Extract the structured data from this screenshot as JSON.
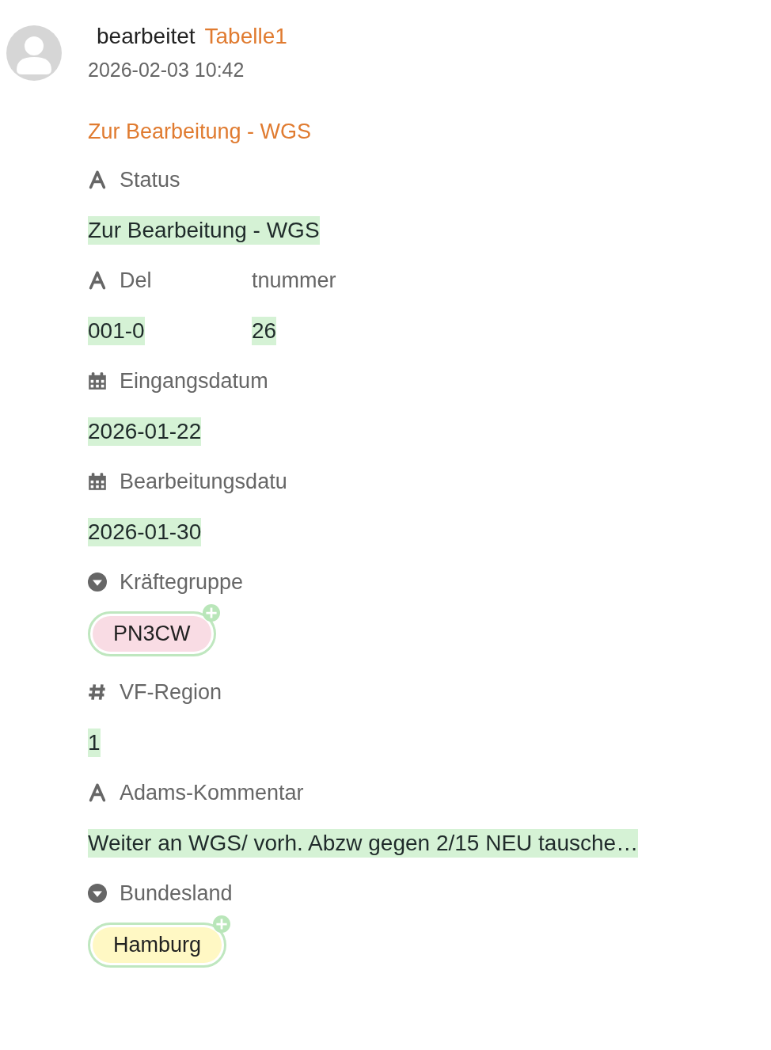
{
  "header": {
    "action": "bearbeitet",
    "table": "Tabelle1",
    "timestamp": "2026-02-03 10:42"
  },
  "record_title": "Zur Bearbeitung - WGS",
  "fields": [
    {
      "kind": "text",
      "label": [
        "Status"
      ],
      "value": [
        "Zur Bearbeitung - WGS"
      ]
    },
    {
      "kind": "text",
      "label": [
        "Del",
        "tnummer"
      ],
      "value": [
        "001-0",
        "26"
      ]
    },
    {
      "kind": "date",
      "label": [
        "Eingangsdatum"
      ],
      "value": [
        "2026-01-22"
      ]
    },
    {
      "kind": "date",
      "label": [
        "Bearbeitungsdatu"
      ],
      "value": [
        "2026-01-30"
      ]
    },
    {
      "kind": "select",
      "label": [
        "Kräftegruppe"
      ],
      "option": {
        "text": "PN3CW",
        "color": "#f9dce4"
      }
    },
    {
      "kind": "number",
      "label": [
        "VF-Region"
      ],
      "value": [
        "1"
      ]
    },
    {
      "kind": "text",
      "label": [
        "Adams-Kommentar"
      ],
      "value": [
        "Weiter an WGS/ vorh. Abzw gegen 2/15 NEU tausche…"
      ]
    },
    {
      "kind": "select",
      "label": [
        "Bundesland"
      ],
      "option": {
        "text": "Hamburg",
        "color": "#fff8c4"
      }
    }
  ]
}
